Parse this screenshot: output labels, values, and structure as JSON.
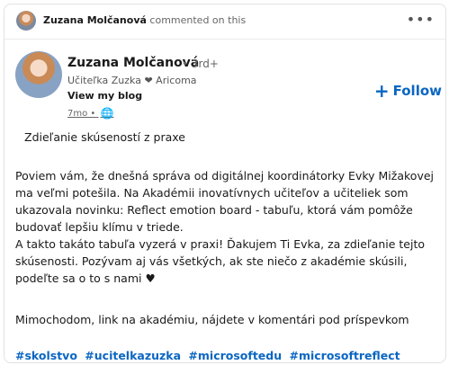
{
  "activity": {
    "actor_name": "Zuzana Molčanová",
    "action_text": "commented on this",
    "more_label": "•••"
  },
  "post_header": {
    "author_name": "Zuzana Molčanová",
    "degree": "• 3rd+",
    "headline": "Učiteľka Zuzka ❤ Aricoma",
    "blog_link": "View my blog",
    "time": "7mo •",
    "visibility_icon": "globe-icon",
    "follow_label": "Follow"
  },
  "post": {
    "title": "Zdieľanie skúseností z praxe",
    "lines": [
      "Poviem vám, že dnešná správa od digitálnej koordinátorky Evky Mižakovej",
      "ma veľmi potešila. Na Akadémii inovatívnych učiteľov a učiteliek som",
      "ukazovala novinku: Reflect emotion board - tabuľu, ktorá vám pomôže",
      "budovať lepšiu klímu v triede.",
      "A takto takáto tabuľa vyzerá v praxi! Ďakujem Ti Evka, za zdieľanie tejto",
      "skúsenosti. Pozývam aj vás všetkých, ak ste niečo z akadémie skúsili,",
      "podeľte sa o to s nami ♥",
      "Mimochodom, link na akadémiu, nájdete v komentári pod príspevkom"
    ],
    "hashtags": [
      "#skolstvo",
      "#ucitelkazuzka",
      "#microsoftedu",
      "#microsoftreflect"
    ]
  },
  "colors": {
    "link_blue": "#0a66c2",
    "text_primary": "#191919",
    "text_secondary": "#666666"
  }
}
